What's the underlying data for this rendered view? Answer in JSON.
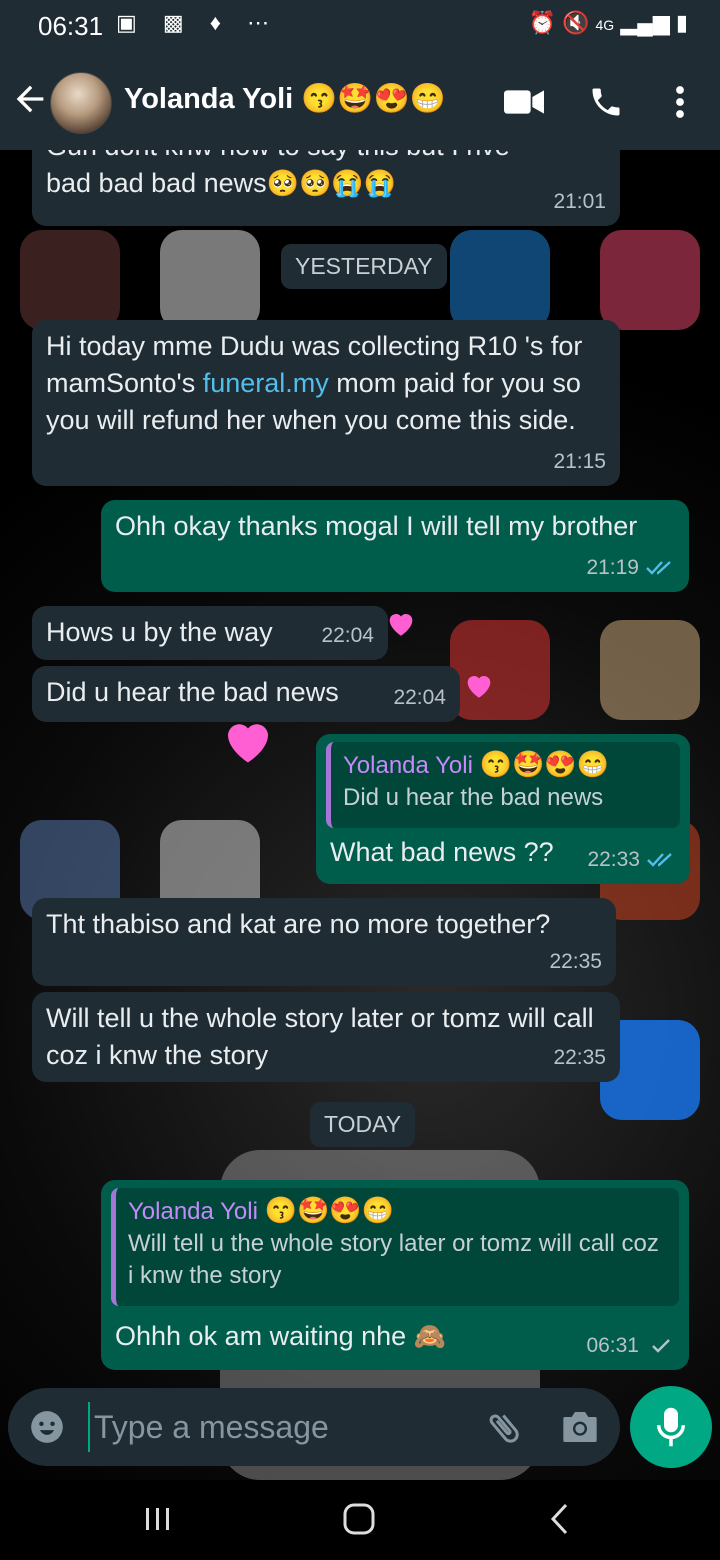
{
  "status_bar": {
    "time": "06:31",
    "network": "4G"
  },
  "header": {
    "contact_name": "Yolanda Yoli",
    "contact_emojis": "😙🤩😍😁"
  },
  "messages": [
    {
      "dir": "in",
      "text_partial": "Gurl dont knw how to say this but I hve",
      "text": "bad bad bad news",
      "emojis": "🥺🥺😭😭",
      "time": "21:01"
    },
    {
      "type": "date",
      "label": "YESTERDAY"
    },
    {
      "dir": "in",
      "text_before": "Hi today mme Dudu was collecting R10 's for mamSonto's ",
      "link": "funeral.my",
      "text_after": " mom paid for you so you will refund her when you come this side.",
      "time": "21:15"
    },
    {
      "dir": "out",
      "text": "Ohh okay thanks mogal I will tell my brother",
      "time": "21:19",
      "status": "read"
    },
    {
      "dir": "in",
      "text": "Hows u by the way",
      "time": "22:04"
    },
    {
      "dir": "in",
      "text": "Did u hear the bad news",
      "time": "22:04"
    },
    {
      "dir": "out",
      "quote_name": "Yolanda Yoli",
      "quote_emojis": "😙🤩😍😁",
      "quote_text": "Did u hear the bad news",
      "text": "What bad news ??",
      "time": "22:33",
      "status": "read"
    },
    {
      "dir": "in",
      "text": "Tht thabiso and kat are no more together?",
      "time": "22:35"
    },
    {
      "dir": "in",
      "text": "Will tell u the whole story later or tomz will call coz i knw the story",
      "time": "22:35"
    },
    {
      "type": "date",
      "label": "TODAY"
    },
    {
      "dir": "out",
      "quote_name": "Yolanda Yoli",
      "quote_emojis": "😙🤩😍😁",
      "quote_text": "Will tell u the whole story later or tomz will call coz i knw the story",
      "text": "Ohhh ok am waiting nhe",
      "emojis": "🙈",
      "time": "06:31",
      "status": "sent"
    }
  ],
  "composer": {
    "placeholder": "Type a message"
  },
  "colors": {
    "incoming": "#1f2c34",
    "outgoing": "#005c4b",
    "accent": "#00a884",
    "read_tick": "#53bdeb",
    "quote_name": "#c58af9"
  },
  "icons": [
    "back-arrow-icon",
    "video-call-icon",
    "phone-icon",
    "more-vert-icon",
    "emoji-icon",
    "attach-icon",
    "camera-icon",
    "mic-icon",
    "recents-icon",
    "home-icon",
    "back-nav-icon"
  ]
}
